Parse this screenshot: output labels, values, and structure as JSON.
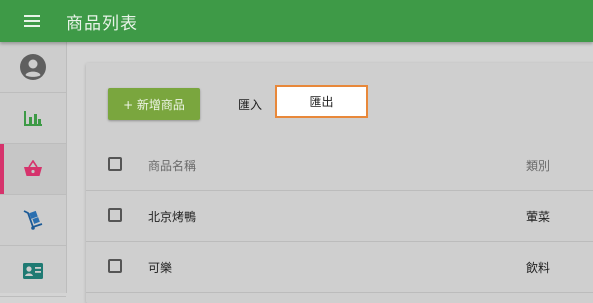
{
  "header": {
    "title": "商品列表",
    "menu_icon": "menu-icon"
  },
  "sidebar": {
    "items": [
      {
        "icon": "account-circle-icon",
        "active": false
      },
      {
        "icon": "bar-chart-icon",
        "active": false
      },
      {
        "icon": "shopping-basket-icon",
        "active": true
      },
      {
        "icon": "cart-icon",
        "active": false
      },
      {
        "icon": "contact-card-icon",
        "active": false
      }
    ]
  },
  "toolbar": {
    "add_label": "+ 新增商品",
    "import_label": "匯入",
    "export_label": "匯出"
  },
  "table": {
    "columns": [
      "商品名稱",
      "類別"
    ],
    "rows": [
      {
        "name": "北京烤鴨",
        "category": "葷菜"
      },
      {
        "name": "可樂",
        "category": "飲料"
      }
    ]
  },
  "colors": {
    "topbar": "#3e9a47",
    "add_button": "#7aa63e",
    "active_accent": "#d6336c",
    "export_border": "#e8883a"
  }
}
